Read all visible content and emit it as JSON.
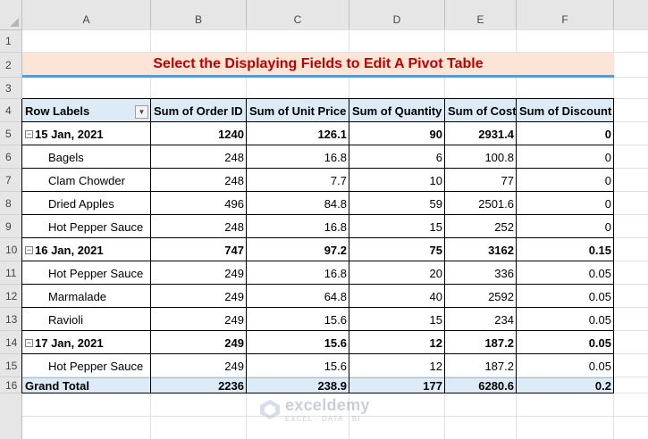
{
  "columns": [
    "A",
    "B",
    "C",
    "D",
    "E",
    "F"
  ],
  "rows": [
    "1",
    "2",
    "3",
    "4",
    "5",
    "6",
    "7",
    "8",
    "9",
    "10",
    "11",
    "12",
    "13",
    "14",
    "15",
    "16"
  ],
  "title": "Select the Displaying Fields to Edit A Pivot Table",
  "pivot": {
    "headers": [
      "Row Labels",
      "Sum of Order ID",
      "Sum of Unit Price",
      "Sum of Quantity",
      "Sum of Cost",
      "Sum of Discount"
    ],
    "body": [
      {
        "type": "group",
        "label": "15 Jan, 2021",
        "values": [
          "1240",
          "126.1",
          "90",
          "2931.4",
          "0"
        ]
      },
      {
        "type": "item",
        "label": "Bagels",
        "values": [
          "248",
          "16.8",
          "6",
          "100.8",
          "0"
        ]
      },
      {
        "type": "item",
        "label": "Clam Chowder",
        "values": [
          "248",
          "7.7",
          "10",
          "77",
          "0"
        ]
      },
      {
        "type": "item",
        "label": "Dried Apples",
        "values": [
          "496",
          "84.8",
          "59",
          "2501.6",
          "0"
        ]
      },
      {
        "type": "item",
        "label": "Hot Pepper Sauce",
        "values": [
          "248",
          "16.8",
          "15",
          "252",
          "0"
        ]
      },
      {
        "type": "group",
        "label": "16 Jan, 2021",
        "values": [
          "747",
          "97.2",
          "75",
          "3162",
          "0.15"
        ]
      },
      {
        "type": "item",
        "label": "Hot Pepper Sauce",
        "values": [
          "249",
          "16.8",
          "20",
          "336",
          "0.05"
        ]
      },
      {
        "type": "item",
        "label": "Marmalade",
        "values": [
          "249",
          "64.8",
          "40",
          "2592",
          "0.05"
        ]
      },
      {
        "type": "item",
        "label": "Ravioli",
        "values": [
          "249",
          "15.6",
          "15",
          "234",
          "0.05"
        ]
      },
      {
        "type": "group",
        "label": "17 Jan, 2021",
        "values": [
          "249",
          "15.6",
          "12",
          "187.2",
          "0.05"
        ]
      },
      {
        "type": "item",
        "label": "Hot Pepper Sauce",
        "values": [
          "249",
          "15.6",
          "12",
          "187.2",
          "0.05"
        ]
      }
    ],
    "grand_total": {
      "label": "Grand Total",
      "values": [
        "2236",
        "238.9",
        "177",
        "6280.6",
        "0.2"
      ]
    }
  },
  "watermark": {
    "name": "exceldemy",
    "tagline": "EXCEL · DATA · BI"
  },
  "icons": {
    "filter": "dropdown-filter-icon",
    "collapse": "collapse-minus-icon"
  },
  "colors": {
    "title_text": "#c00000",
    "title_fill": "#fce4d6",
    "header_fill": "#ddebf7",
    "accent_line": "#5b9bd5"
  }
}
